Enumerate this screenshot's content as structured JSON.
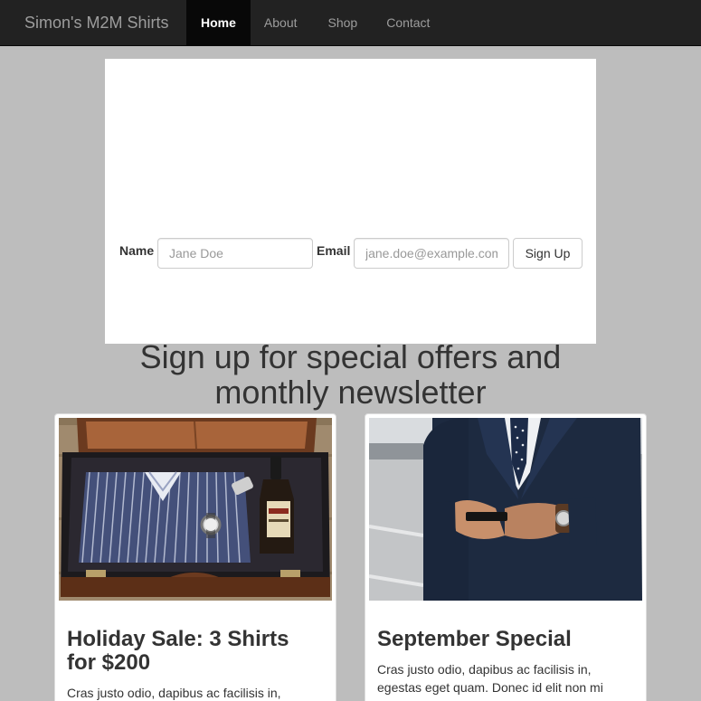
{
  "navbar": {
    "brand": "Simon's M2M Shirts",
    "items": [
      {
        "label": "Home",
        "active": true
      },
      {
        "label": "About",
        "active": false
      },
      {
        "label": "Shop",
        "active": false
      },
      {
        "label": "Contact",
        "active": false
      }
    ]
  },
  "signup": {
    "title": "Sign up for special offers and monthly newsletter",
    "name_label": "Name",
    "name_placeholder": "Jane Doe",
    "email_label": "Email",
    "email_placeholder": "jane.doe@example.com",
    "button_label": "Sign Up"
  },
  "cards": [
    {
      "title": "Holiday Sale: 3 Shirts for $200",
      "text": "Cras justo odio, dapibus ac facilisis in,",
      "image": "suitcase-with-striped-shirt-photo"
    },
    {
      "title": "September Special",
      "text": "Cras justo odio, dapibus ac facilisis in, egestas eget quam. Donec id elit non mi porta gravida at eget metus. Nullam id dolor",
      "image": "man-in-suit-holding-phone-photo"
    }
  ],
  "colors": {
    "navbar_bg": "#222222",
    "page_bg": "#bdbdbd",
    "active_nav_bg": "#080808"
  }
}
